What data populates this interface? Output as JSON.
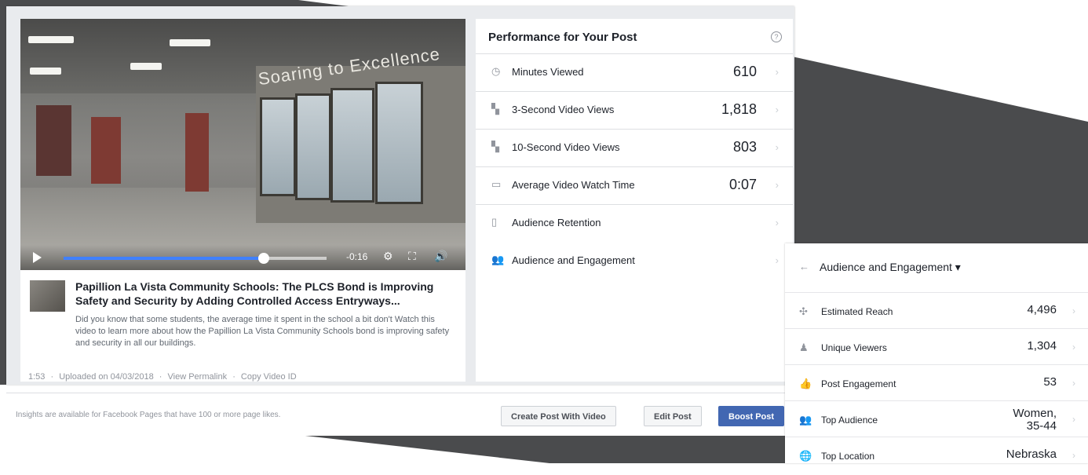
{
  "post": {
    "title": "Papillion La Vista Community Schools: The PLCS Bond is Improving Safety and Security by Adding Controlled Access Entryways...",
    "description": "Did you know that some students, the average time it spent in the school a bit don't Watch this video to learn more about how the Papillion La Vista Community Schools bond is improving safety and security in all our buildings.",
    "meta": {
      "duration": "1:53",
      "uploaded": "Uploaded on 04/03/2018",
      "permalink": "View Permalink",
      "video_id": "Copy Video ID"
    },
    "video": {
      "sign_text": "Soaring to Excellence",
      "time_left": "-0:16",
      "progress": 0.76
    }
  },
  "performance": {
    "title": "Performance for Your Post",
    "help": "?",
    "metrics": [
      {
        "icon": "clock-icon",
        "glyph": "◷",
        "label": "Minutes Viewed",
        "value": "610"
      },
      {
        "icon": "video-views-icon",
        "glyph": "▚",
        "label": "3-Second Video Views",
        "value": "1,818"
      },
      {
        "icon": "video-views-10s-icon",
        "glyph": "▚",
        "label": "10-Second Video Views",
        "value": "803"
      },
      {
        "icon": "watch-time-icon",
        "glyph": "▭",
        "label": "Average Video Watch Time",
        "value": "0:07"
      },
      {
        "icon": "audience-retention-icon",
        "glyph": "▯",
        "label": "Audience Retention",
        "value": ""
      },
      {
        "icon": "audience-engagement-icon",
        "glyph": "👥",
        "label": "Audience and Engagement",
        "value": ""
      }
    ]
  },
  "footer": {
    "note": "Insights are available for Facebook Pages that have 100 or more page likes.",
    "create_post": "Create Post With Video",
    "edit_post": "Edit Post",
    "boost_post": "Boost Post"
  },
  "audience_engagement": {
    "title": "Audience and Engagement ▾",
    "rows": [
      {
        "icon": "reach-icon",
        "glyph": "✣",
        "label": "Estimated Reach",
        "value": "4,496"
      },
      {
        "icon": "person-icon",
        "glyph": "♟",
        "label": "Unique Viewers",
        "value": "1,304"
      },
      {
        "icon": "like-icon",
        "glyph": "👍",
        "label": "Post Engagement",
        "value": "53"
      },
      {
        "icon": "group-icon",
        "glyph": "👥",
        "label": "Top Audience",
        "value": "Women, 35-44"
      },
      {
        "icon": "globe-icon",
        "glyph": "🌐",
        "label": "Top Location",
        "value": "Nebraska"
      }
    ]
  },
  "colors": {
    "accent": "#4267b2",
    "seek": "#4080ff",
    "background_shape": "#4a4b4d"
  }
}
